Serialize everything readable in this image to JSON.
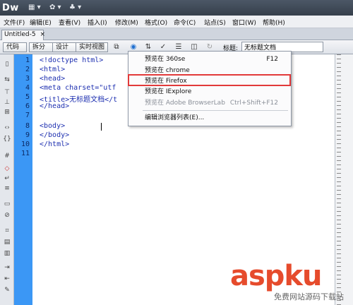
{
  "app": {
    "logo": "Dw"
  },
  "menu": {
    "items": [
      "文件(F)",
      "编辑(E)",
      "查看(V)",
      "插入(I)",
      "修改(M)",
      "格式(O)",
      "命令(C)",
      "站点(S)",
      "窗口(W)",
      "帮助(H)"
    ]
  },
  "tab": {
    "label": "Untitled-5",
    "close": "×"
  },
  "toolbar": {
    "code_label": "代码",
    "split_label": "拆分",
    "design_label": "设计",
    "live_label": "实时视图",
    "title_label": "标题:",
    "title_value": "无标题文档"
  },
  "editor": {
    "line_numbers": [
      "1",
      "2",
      "3",
      "4",
      "5",
      "6",
      "7",
      "8",
      "9",
      "10",
      "11"
    ],
    "lines": [
      "<!doctype html>",
      "<html>",
      "<head>",
      "<meta charset=\"utf",
      "<title>无标题文档</t",
      "</head>",
      "",
      "<body>",
      "</body>",
      "</html>",
      ""
    ]
  },
  "dropdown": {
    "items": [
      {
        "label": "预览在 360se",
        "shortcut": "F12",
        "disabled": false
      },
      {
        "label": "预览在 chrome",
        "shortcut": "",
        "disabled": false
      },
      {
        "label": "预览在 Firefox",
        "shortcut": "",
        "disabled": false
      },
      {
        "label": "预览在 IExplore",
        "shortcut": "",
        "disabled": false
      },
      {
        "label": "预览在 Adobe BrowserLab",
        "shortcut": "Ctrl+Shift+F12",
        "disabled": true
      },
      {
        "label": "编辑浏览器列表(E)...",
        "shortcut": "",
        "disabled": false
      }
    ],
    "highlight_color": "#e23a3a"
  },
  "watermark": {
    "main": "aspku",
    "sub": "免费网站源码下载站"
  }
}
